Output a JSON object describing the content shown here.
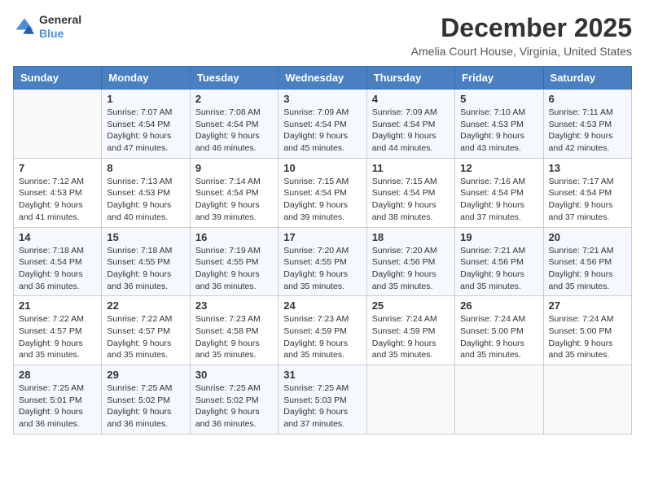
{
  "logo": {
    "text1": "General",
    "text2": "Blue"
  },
  "title": "December 2025",
  "location": "Amelia Court House, Virginia, United States",
  "weekdays": [
    "Sunday",
    "Monday",
    "Tuesday",
    "Wednesday",
    "Thursday",
    "Friday",
    "Saturday"
  ],
  "weeks": [
    [
      {
        "day": "",
        "sunrise": "",
        "sunset": "",
        "daylight": ""
      },
      {
        "day": "1",
        "sunrise": "Sunrise: 7:07 AM",
        "sunset": "Sunset: 4:54 PM",
        "daylight": "Daylight: 9 hours and 47 minutes."
      },
      {
        "day": "2",
        "sunrise": "Sunrise: 7:08 AM",
        "sunset": "Sunset: 4:54 PM",
        "daylight": "Daylight: 9 hours and 46 minutes."
      },
      {
        "day": "3",
        "sunrise": "Sunrise: 7:09 AM",
        "sunset": "Sunset: 4:54 PM",
        "daylight": "Daylight: 9 hours and 45 minutes."
      },
      {
        "day": "4",
        "sunrise": "Sunrise: 7:09 AM",
        "sunset": "Sunset: 4:54 PM",
        "daylight": "Daylight: 9 hours and 44 minutes."
      },
      {
        "day": "5",
        "sunrise": "Sunrise: 7:10 AM",
        "sunset": "Sunset: 4:53 PM",
        "daylight": "Daylight: 9 hours and 43 minutes."
      },
      {
        "day": "6",
        "sunrise": "Sunrise: 7:11 AM",
        "sunset": "Sunset: 4:53 PM",
        "daylight": "Daylight: 9 hours and 42 minutes."
      }
    ],
    [
      {
        "day": "7",
        "sunrise": "Sunrise: 7:12 AM",
        "sunset": "Sunset: 4:53 PM",
        "daylight": "Daylight: 9 hours and 41 minutes."
      },
      {
        "day": "8",
        "sunrise": "Sunrise: 7:13 AM",
        "sunset": "Sunset: 4:53 PM",
        "daylight": "Daylight: 9 hours and 40 minutes."
      },
      {
        "day": "9",
        "sunrise": "Sunrise: 7:14 AM",
        "sunset": "Sunset: 4:54 PM",
        "daylight": "Daylight: 9 hours and 39 minutes."
      },
      {
        "day": "10",
        "sunrise": "Sunrise: 7:15 AM",
        "sunset": "Sunset: 4:54 PM",
        "daylight": "Daylight: 9 hours and 39 minutes."
      },
      {
        "day": "11",
        "sunrise": "Sunrise: 7:15 AM",
        "sunset": "Sunset: 4:54 PM",
        "daylight": "Daylight: 9 hours and 38 minutes."
      },
      {
        "day": "12",
        "sunrise": "Sunrise: 7:16 AM",
        "sunset": "Sunset: 4:54 PM",
        "daylight": "Daylight: 9 hours and 37 minutes."
      },
      {
        "day": "13",
        "sunrise": "Sunrise: 7:17 AM",
        "sunset": "Sunset: 4:54 PM",
        "daylight": "Daylight: 9 hours and 37 minutes."
      }
    ],
    [
      {
        "day": "14",
        "sunrise": "Sunrise: 7:18 AM",
        "sunset": "Sunset: 4:54 PM",
        "daylight": "Daylight: 9 hours and 36 minutes."
      },
      {
        "day": "15",
        "sunrise": "Sunrise: 7:18 AM",
        "sunset": "Sunset: 4:55 PM",
        "daylight": "Daylight: 9 hours and 36 minutes."
      },
      {
        "day": "16",
        "sunrise": "Sunrise: 7:19 AM",
        "sunset": "Sunset: 4:55 PM",
        "daylight": "Daylight: 9 hours and 36 minutes."
      },
      {
        "day": "17",
        "sunrise": "Sunrise: 7:20 AM",
        "sunset": "Sunset: 4:55 PM",
        "daylight": "Daylight: 9 hours and 35 minutes."
      },
      {
        "day": "18",
        "sunrise": "Sunrise: 7:20 AM",
        "sunset": "Sunset: 4:56 PM",
        "daylight": "Daylight: 9 hours and 35 minutes."
      },
      {
        "day": "19",
        "sunrise": "Sunrise: 7:21 AM",
        "sunset": "Sunset: 4:56 PM",
        "daylight": "Daylight: 9 hours and 35 minutes."
      },
      {
        "day": "20",
        "sunrise": "Sunrise: 7:21 AM",
        "sunset": "Sunset: 4:56 PM",
        "daylight": "Daylight: 9 hours and 35 minutes."
      }
    ],
    [
      {
        "day": "21",
        "sunrise": "Sunrise: 7:22 AM",
        "sunset": "Sunset: 4:57 PM",
        "daylight": "Daylight: 9 hours and 35 minutes."
      },
      {
        "day": "22",
        "sunrise": "Sunrise: 7:22 AM",
        "sunset": "Sunset: 4:57 PM",
        "daylight": "Daylight: 9 hours and 35 minutes."
      },
      {
        "day": "23",
        "sunrise": "Sunrise: 7:23 AM",
        "sunset": "Sunset: 4:58 PM",
        "daylight": "Daylight: 9 hours and 35 minutes."
      },
      {
        "day": "24",
        "sunrise": "Sunrise: 7:23 AM",
        "sunset": "Sunset: 4:59 PM",
        "daylight": "Daylight: 9 hours and 35 minutes."
      },
      {
        "day": "25",
        "sunrise": "Sunrise: 7:24 AM",
        "sunset": "Sunset: 4:59 PM",
        "daylight": "Daylight: 9 hours and 35 minutes."
      },
      {
        "day": "26",
        "sunrise": "Sunrise: 7:24 AM",
        "sunset": "Sunset: 5:00 PM",
        "daylight": "Daylight: 9 hours and 35 minutes."
      },
      {
        "day": "27",
        "sunrise": "Sunrise: 7:24 AM",
        "sunset": "Sunset: 5:00 PM",
        "daylight": "Daylight: 9 hours and 35 minutes."
      }
    ],
    [
      {
        "day": "28",
        "sunrise": "Sunrise: 7:25 AM",
        "sunset": "Sunset: 5:01 PM",
        "daylight": "Daylight: 9 hours and 36 minutes."
      },
      {
        "day": "29",
        "sunrise": "Sunrise: 7:25 AM",
        "sunset": "Sunset: 5:02 PM",
        "daylight": "Daylight: 9 hours and 36 minutes."
      },
      {
        "day": "30",
        "sunrise": "Sunrise: 7:25 AM",
        "sunset": "Sunset: 5:02 PM",
        "daylight": "Daylight: 9 hours and 36 minutes."
      },
      {
        "day": "31",
        "sunrise": "Sunrise: 7:25 AM",
        "sunset": "Sunset: 5:03 PM",
        "daylight": "Daylight: 9 hours and 37 minutes."
      },
      {
        "day": "",
        "sunrise": "",
        "sunset": "",
        "daylight": ""
      },
      {
        "day": "",
        "sunrise": "",
        "sunset": "",
        "daylight": ""
      },
      {
        "day": "",
        "sunrise": "",
        "sunset": "",
        "daylight": ""
      }
    ]
  ]
}
